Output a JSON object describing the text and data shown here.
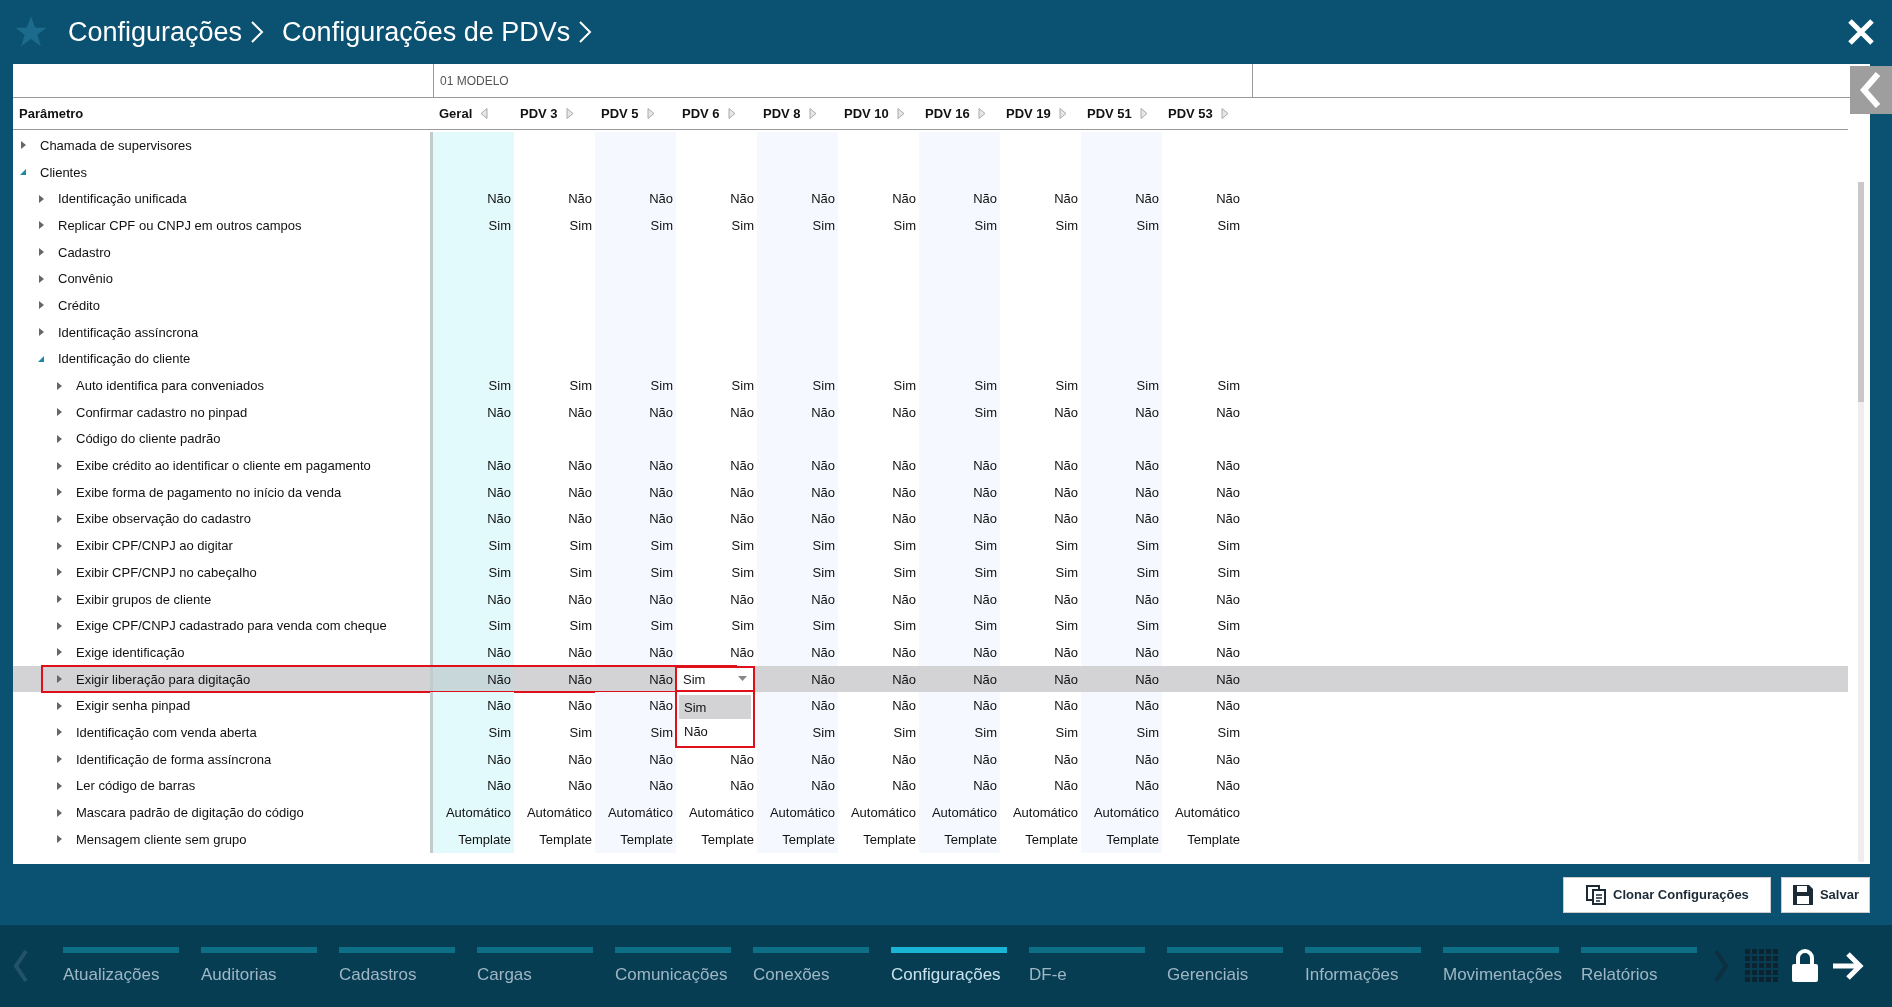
{
  "header": {
    "breadcrumbs": [
      {
        "label": "Configurações"
      },
      {
        "label": "Configurações de PDVs"
      }
    ]
  },
  "table": {
    "group_label": "01 MODELO",
    "parameter_header": "Parâmetro",
    "columns": [
      {
        "label": "Geral",
        "expanded": true
      },
      {
        "label": "PDV 3",
        "expanded": false
      },
      {
        "label": "PDV 5",
        "expanded": false
      },
      {
        "label": "PDV 6",
        "expanded": false
      },
      {
        "label": "PDV 8",
        "expanded": false
      },
      {
        "label": "PDV 10",
        "expanded": false
      },
      {
        "label": "PDV 16",
        "expanded": false
      },
      {
        "label": "PDV 19",
        "expanded": false
      },
      {
        "label": "PDV 51",
        "expanded": false
      },
      {
        "label": "PDV 53",
        "expanded": false
      }
    ],
    "rows": [
      {
        "label": "Chamada de supervisores",
        "expanded": false,
        "selected": false
      },
      {
        "label": "Clientes",
        "expanded": true,
        "selected": false,
        "children": [
          {
            "label": "Identificação unificada",
            "expanded": false,
            "selected": false,
            "values": [
              "Não",
              "Não",
              "Não",
              "Não",
              "Não",
              "Não",
              "Não",
              "Não",
              "Não",
              "Não"
            ]
          },
          {
            "label": "Replicar CPF ou CNPJ em outros campos",
            "expanded": false,
            "selected": false,
            "values": [
              "Sim",
              "Sim",
              "Sim",
              "Sim",
              "Sim",
              "Sim",
              "Sim",
              "Sim",
              "Sim",
              "Sim"
            ]
          },
          {
            "label": "Cadastro",
            "expanded": false,
            "selected": false
          },
          {
            "label": "Convênio",
            "expanded": false,
            "selected": false
          },
          {
            "label": "Crédito",
            "expanded": false,
            "selected": false
          },
          {
            "label": "Identificação assíncrona",
            "expanded": false,
            "selected": false
          },
          {
            "label": "Identificação do cliente",
            "expanded": true,
            "selected": false,
            "children": [
              {
                "label": "Auto identifica para conveniados",
                "expanded": false,
                "selected": false,
                "values": [
                  "Sim",
                  "Sim",
                  "Sim",
                  "Sim",
                  "Sim",
                  "Sim",
                  "Sim",
                  "Sim",
                  "Sim",
                  "Sim"
                ]
              },
              {
                "label": "Confirmar cadastro no pinpad",
                "expanded": false,
                "selected": false,
                "values": [
                  "Não",
                  "Não",
                  "Não",
                  "Não",
                  "Não",
                  "Não",
                  "Sim",
                  "Não",
                  "Não",
                  "Não"
                ]
              },
              {
                "label": "Código do cliente padrão",
                "expanded": false,
                "selected": false
              },
              {
                "label": "Exibe crédito ao identificar o cliente em pagamento",
                "expanded": false,
                "selected": false,
                "values": [
                  "Não",
                  "Não",
                  "Não",
                  "Não",
                  "Não",
                  "Não",
                  "Não",
                  "Não",
                  "Não",
                  "Não"
                ]
              },
              {
                "label": "Exibe forma de pagamento no início da venda",
                "expanded": false,
                "selected": false,
                "values": [
                  "Não",
                  "Não",
                  "Não",
                  "Não",
                  "Não",
                  "Não",
                  "Não",
                  "Não",
                  "Não",
                  "Não"
                ]
              },
              {
                "label": "Exibe observação do cadastro",
                "expanded": false,
                "selected": false,
                "values": [
                  "Não",
                  "Não",
                  "Não",
                  "Não",
                  "Não",
                  "Não",
                  "Não",
                  "Não",
                  "Não",
                  "Não"
                ]
              },
              {
                "label": "Exibir CPF/CNPJ ao digitar",
                "expanded": false,
                "selected": false,
                "values": [
                  "Sim",
                  "Sim",
                  "Sim",
                  "Sim",
                  "Sim",
                  "Sim",
                  "Sim",
                  "Sim",
                  "Sim",
                  "Sim"
                ]
              },
              {
                "label": "Exibir CPF/CNPJ no cabeçalho",
                "expanded": false,
                "selected": false,
                "values": [
                  "Sim",
                  "Sim",
                  "Sim",
                  "Sim",
                  "Sim",
                  "Sim",
                  "Sim",
                  "Sim",
                  "Sim",
                  "Sim"
                ]
              },
              {
                "label": "Exibir grupos de cliente",
                "expanded": false,
                "selected": false,
                "values": [
                  "Não",
                  "Não",
                  "Não",
                  "Não",
                  "Não",
                  "Não",
                  "Não",
                  "Não",
                  "Não",
                  "Não"
                ]
              },
              {
                "label": "Exige CPF/CNPJ cadastrado para venda com cheque",
                "expanded": false,
                "selected": false,
                "values": [
                  "Sim",
                  "Sim",
                  "Sim",
                  "Sim",
                  "Sim",
                  "Sim",
                  "Sim",
                  "Sim",
                  "Sim",
                  "Sim"
                ]
              },
              {
                "label": "Exige identificação",
                "expanded": false,
                "selected": false,
                "values": [
                  "Não",
                  "Não",
                  "Não",
                  "Não",
                  "Não",
                  "Não",
                  "Não",
                  "Não",
                  "Não",
                  "Não"
                ]
              },
              {
                "label": "Exigir liberação para digitação",
                "expanded": false,
                "selected": true,
                "values": [
                  "Não",
                  "Não",
                  "Não",
                  {
                    "kind": "dropdown",
                    "value": "Sim",
                    "options": [
                      {
                        "label": "Sim",
                        "selected": true
                      },
                      {
                        "label": "Não",
                        "selected": false
                      }
                    ]
                  },
                  "Não",
                  "Não",
                  "Não",
                  "Não",
                  "Não",
                  "Não"
                ]
              },
              {
                "label": "Exigir senha pinpad",
                "expanded": false,
                "selected": false,
                "values": [
                  "Não",
                  "Não",
                  "Não",
                  {
                    "kind": "covered"
                  },
                  "Não",
                  "Não",
                  "Não",
                  "Não",
                  "Não",
                  "Não"
                ]
              },
              {
                "label": "Identificação com venda aberta",
                "expanded": false,
                "selected": false,
                "values": [
                  "Sim",
                  "Sim",
                  "Sim",
                  {
                    "kind": "covered"
                  },
                  "Sim",
                  "Sim",
                  "Sim",
                  "Sim",
                  "Sim",
                  "Sim"
                ]
              },
              {
                "label": "Identificação de forma assíncrona",
                "expanded": false,
                "selected": false,
                "values": [
                  "Não",
                  "Não",
                  "Não",
                  "Não",
                  "Não",
                  "Não",
                  "Não",
                  "Não",
                  "Não",
                  "Não"
                ]
              },
              {
                "label": "Ler código de barras",
                "expanded": false,
                "selected": false,
                "values": [
                  "Não",
                  "Não",
                  "Não",
                  "Não",
                  "Não",
                  "Não",
                  "Não",
                  "Não",
                  "Não",
                  "Não"
                ]
              },
              {
                "label": "Mascara padrão de digitação do código",
                "expanded": false,
                "selected": false,
                "values": [
                  "Automático",
                  "Automático",
                  "Automático",
                  "Automático",
                  "Automático",
                  "Automático",
                  "Automático",
                  "Automático",
                  "Automático",
                  "Automático"
                ]
              },
              {
                "label": "Mensagem cliente sem grupo",
                "expanded": false,
                "selected": false,
                "values": [
                  "Template",
                  "Template",
                  "Template",
                  "Template",
                  "Template",
                  "Template",
                  "Template",
                  "Template",
                  "Template",
                  "Template"
                ]
              }
            ]
          }
        ]
      }
    ]
  },
  "actions": [
    {
      "label": "Clonar Configurações",
      "kind": "clone"
    },
    {
      "label": "Salvar",
      "kind": "save"
    }
  ],
  "nav": {
    "items": [
      {
        "label": "Atualizações",
        "selected": false
      },
      {
        "label": "Auditorias",
        "selected": false
      },
      {
        "label": "Cadastros",
        "selected": false
      },
      {
        "label": "Cargas",
        "selected": false
      },
      {
        "label": "Comunicações",
        "selected": false
      },
      {
        "label": "Conexões",
        "selected": false
      },
      {
        "label": "Configurações",
        "selected": true
      },
      {
        "label": "DF-e",
        "selected": false
      },
      {
        "label": "Gerenciais",
        "selected": false
      },
      {
        "label": "Informações",
        "selected": false
      },
      {
        "label": "Movimentações",
        "selected": false
      },
      {
        "label": "Relatórios",
        "selected": false
      }
    ]
  }
}
